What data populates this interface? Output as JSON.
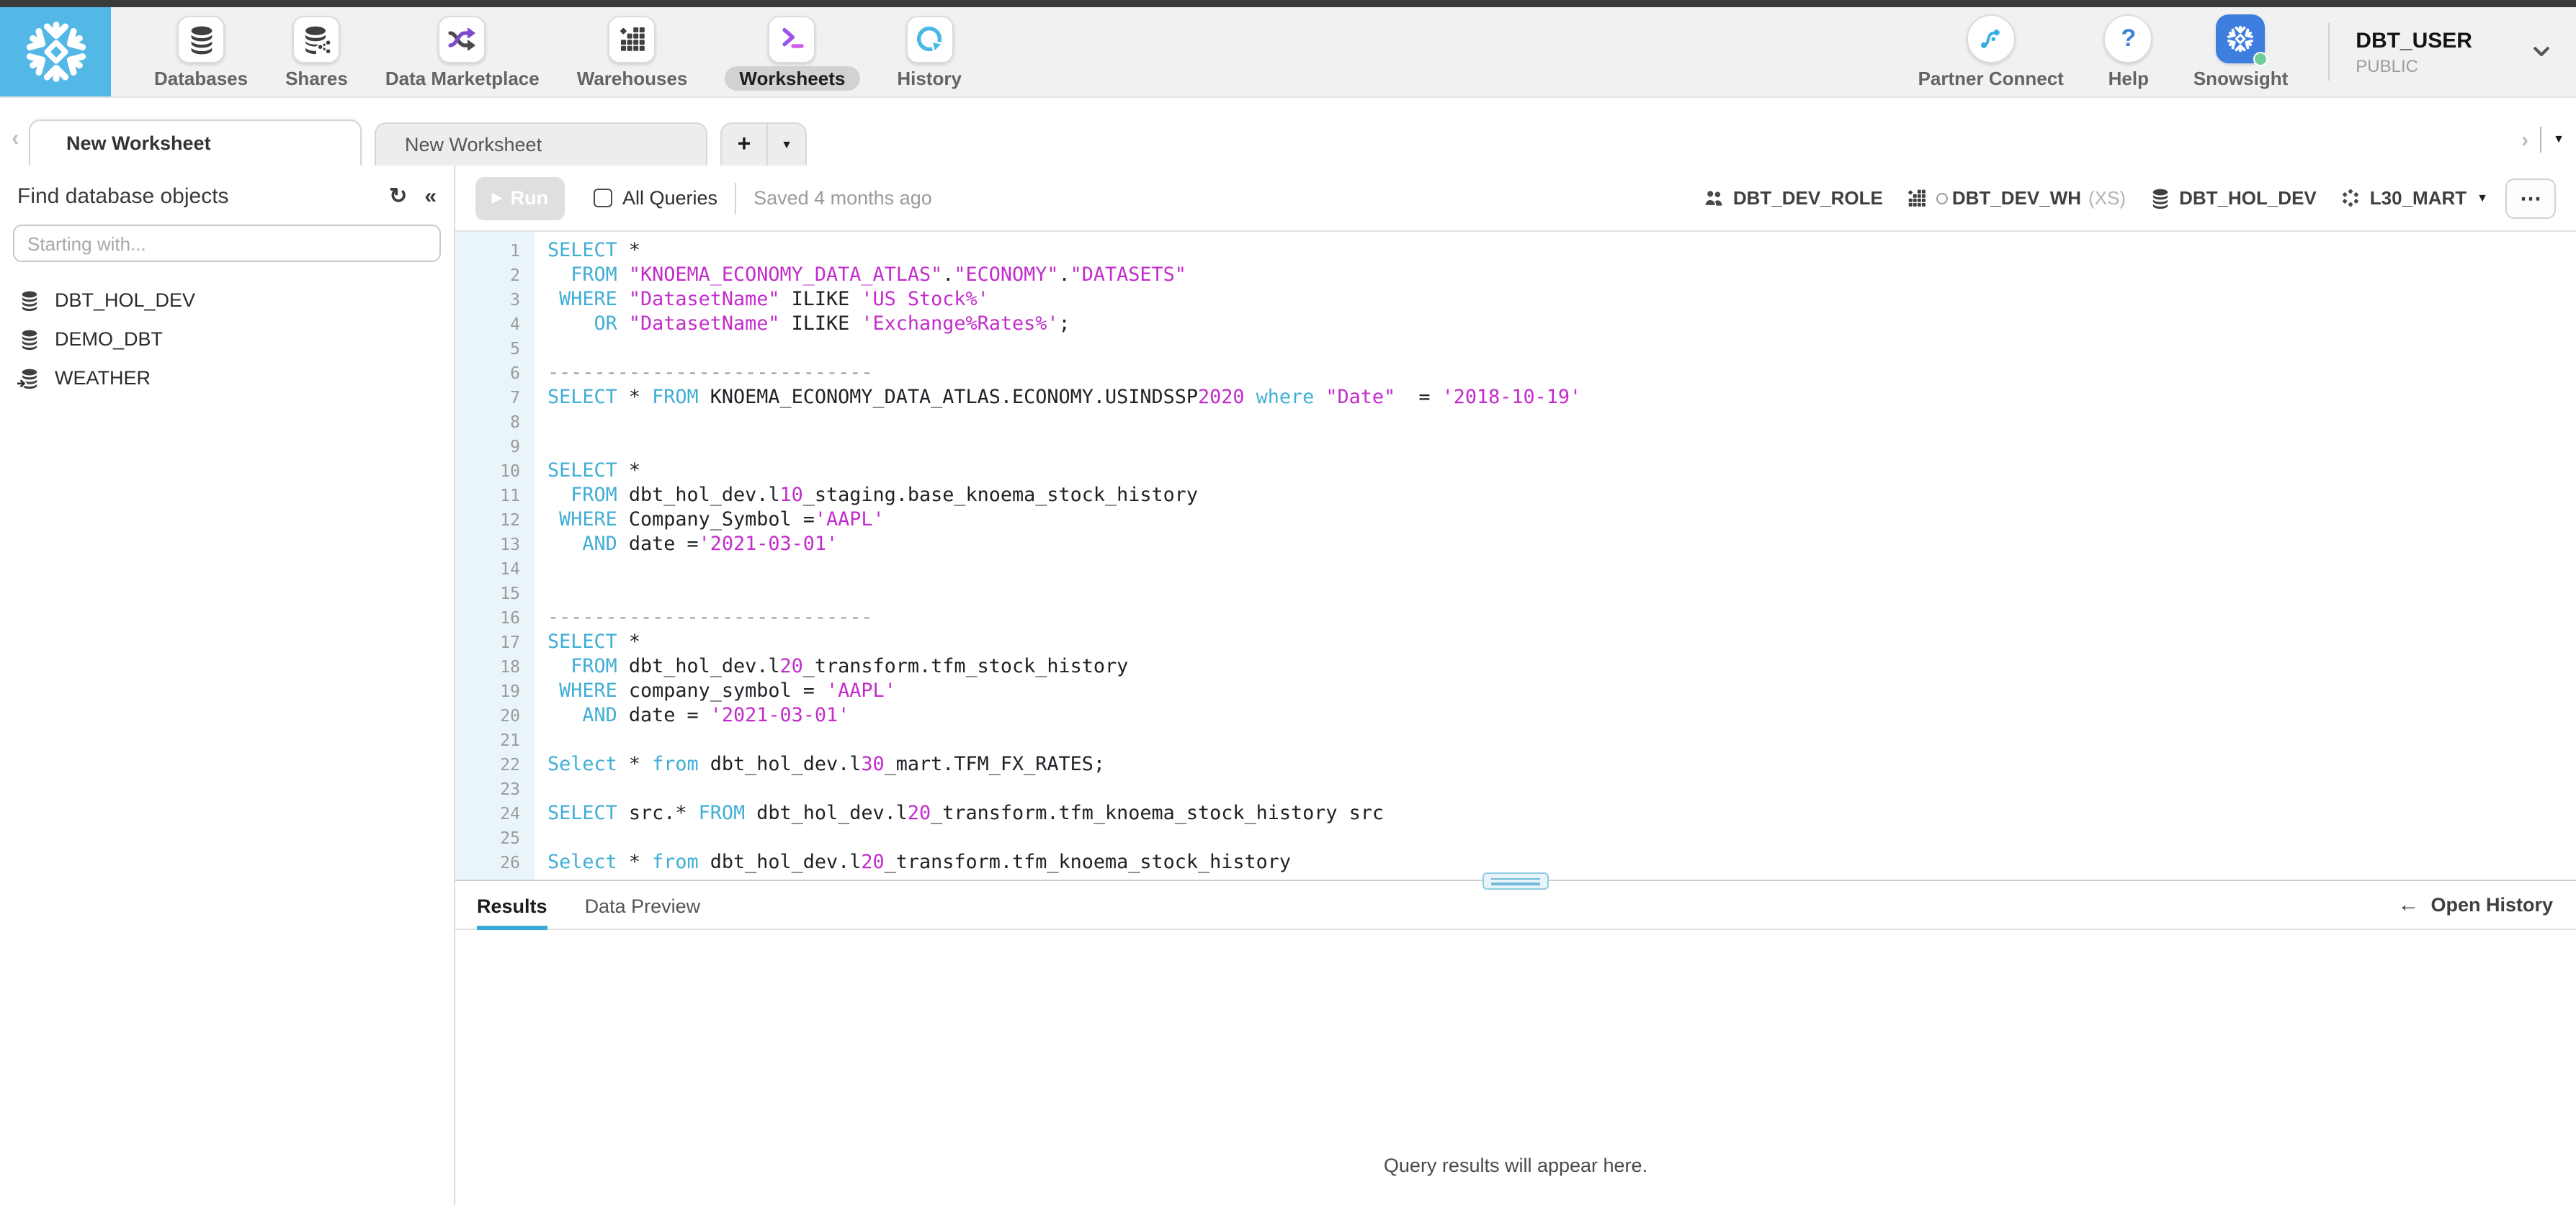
{
  "topnav": {
    "items": [
      {
        "icon": "databases-icon",
        "label": "Databases",
        "active": false
      },
      {
        "icon": "shares-icon",
        "label": "Shares",
        "active": false
      },
      {
        "icon": "marketplace-icon",
        "label": "Data Marketplace",
        "active": false
      },
      {
        "icon": "warehouses-icon",
        "label": "Warehouses",
        "active": false
      },
      {
        "icon": "worksheets-icon",
        "label": "Worksheets",
        "active": true
      },
      {
        "icon": "history-icon",
        "label": "History",
        "active": false
      }
    ],
    "right_items": [
      {
        "icon": "partner-connect-icon",
        "label": "Partner Connect"
      },
      {
        "icon": "help-icon",
        "label": "Help"
      },
      {
        "icon": "snowsight-icon",
        "label": "Snowsight"
      }
    ],
    "user": {
      "name": "DBT_USER",
      "role": "PUBLIC"
    }
  },
  "tabbar": {
    "tabs": [
      {
        "label": "New Worksheet",
        "active": true
      },
      {
        "label": "New Worksheet",
        "active": false
      }
    ],
    "add_label": "+",
    "menu_caret": "▼",
    "scroll_left": "‹",
    "scroll_right": "›"
  },
  "sidebar": {
    "title": "Find database objects",
    "refresh_icon": "↻",
    "collapse_icon": "«",
    "search_placeholder": "Starting with...",
    "databases": [
      {
        "name": "DBT_HOL_DEV",
        "shared": false
      },
      {
        "name": "DEMO_DBT",
        "shared": false
      },
      {
        "name": "WEATHER",
        "shared": true
      }
    ]
  },
  "toolbar": {
    "run_label": "Run",
    "run_play": "▶",
    "all_queries_label": "All Queries",
    "saved_status": "Saved 4 months ago",
    "context": [
      {
        "icon": "role-icon",
        "label": "DBT_DEV_ROLE",
        "status_dot": false,
        "suffix": "",
        "dropdown": false
      },
      {
        "icon": "warehouse-icon",
        "label": "DBT_DEV_WH",
        "status_dot": true,
        "suffix": "(XS)",
        "dropdown": false
      },
      {
        "icon": "database-icon",
        "label": "DBT_HOL_DEV",
        "status_dot": false,
        "suffix": "",
        "dropdown": false
      },
      {
        "icon": "schema-icon",
        "label": "L30_MART",
        "status_dot": false,
        "suffix": "",
        "dropdown": true
      }
    ],
    "more_label": "⋯"
  },
  "editor": {
    "lines": [
      {
        "n": 1,
        "t": [
          [
            "k",
            "SELECT"
          ],
          [
            "p",
            " *"
          ]
        ]
      },
      {
        "n": 2,
        "t": [
          [
            "p",
            "  "
          ],
          [
            "k",
            "FROM"
          ],
          [
            "p",
            " "
          ],
          [
            "s",
            "\"KNOEMA_ECONOMY_DATA_ATLAS\""
          ],
          [
            "p",
            "."
          ],
          [
            "s",
            "\"ECONOMY\""
          ],
          [
            "p",
            "."
          ],
          [
            "s",
            "\"DATASETS\""
          ]
        ]
      },
      {
        "n": 3,
        "t": [
          [
            "p",
            " "
          ],
          [
            "k",
            "WHERE"
          ],
          [
            "p",
            " "
          ],
          [
            "s",
            "\"DatasetName\""
          ],
          [
            "p",
            " ILIKE "
          ],
          [
            "s",
            "'US Stock%'"
          ]
        ]
      },
      {
        "n": 4,
        "t": [
          [
            "p",
            "    "
          ],
          [
            "k",
            "OR"
          ],
          [
            "p",
            " "
          ],
          [
            "s",
            "\"DatasetName\""
          ],
          [
            "p",
            " ILIKE "
          ],
          [
            "s",
            "'Exchange%Rates%'"
          ],
          [
            "p",
            ";"
          ]
        ]
      },
      {
        "n": 5,
        "t": []
      },
      {
        "n": 6,
        "t": [
          [
            "c",
            "----------------------------"
          ]
        ]
      },
      {
        "n": 7,
        "t": [
          [
            "k",
            "SELECT"
          ],
          [
            "p",
            " * "
          ],
          [
            "k",
            "FROM"
          ],
          [
            "p",
            " KNOEMA_ECONOMY_DATA_ATLAS.ECONOMY.USINDSSP"
          ],
          [
            "s",
            "2020"
          ],
          [
            "p",
            " "
          ],
          [
            "k",
            "where"
          ],
          [
            "p",
            " "
          ],
          [
            "s",
            "\"Date\""
          ],
          [
            "p",
            "  = "
          ],
          [
            "s",
            "'2018-10-19'"
          ]
        ]
      },
      {
        "n": 8,
        "t": []
      },
      {
        "n": 9,
        "t": []
      },
      {
        "n": 10,
        "t": [
          [
            "k",
            "SELECT"
          ],
          [
            "p",
            " *"
          ]
        ]
      },
      {
        "n": 11,
        "t": [
          [
            "p",
            "  "
          ],
          [
            "k",
            "FROM"
          ],
          [
            "p",
            " dbt_hol_dev.l"
          ],
          [
            "s",
            "10"
          ],
          [
            "p",
            "_staging.base_knoema_stock_history"
          ]
        ]
      },
      {
        "n": 12,
        "t": [
          [
            "p",
            " "
          ],
          [
            "k",
            "WHERE"
          ],
          [
            "p",
            " Company_Symbol ="
          ],
          [
            "s",
            "'AAPL'"
          ]
        ]
      },
      {
        "n": 13,
        "t": [
          [
            "p",
            "   "
          ],
          [
            "k",
            "AND"
          ],
          [
            "p",
            " date ="
          ],
          [
            "s",
            "'2021-03-01'"
          ]
        ]
      },
      {
        "n": 14,
        "t": []
      },
      {
        "n": 15,
        "t": []
      },
      {
        "n": 16,
        "t": [
          [
            "c",
            "----------------------------"
          ]
        ]
      },
      {
        "n": 17,
        "t": [
          [
            "k",
            "SELECT"
          ],
          [
            "p",
            " *"
          ]
        ]
      },
      {
        "n": 18,
        "t": [
          [
            "p",
            "  "
          ],
          [
            "k",
            "FROM"
          ],
          [
            "p",
            " dbt_hol_dev.l"
          ],
          [
            "s",
            "20"
          ],
          [
            "p",
            "_transform.tfm_stock_history"
          ]
        ]
      },
      {
        "n": 19,
        "t": [
          [
            "p",
            " "
          ],
          [
            "k",
            "WHERE"
          ],
          [
            "p",
            " company_symbol = "
          ],
          [
            "s",
            "'AAPL'"
          ]
        ]
      },
      {
        "n": 20,
        "t": [
          [
            "p",
            "   "
          ],
          [
            "k",
            "AND"
          ],
          [
            "p",
            " date = "
          ],
          [
            "s",
            "'2021-03-01'"
          ]
        ]
      },
      {
        "n": 21,
        "t": []
      },
      {
        "n": 22,
        "t": [
          [
            "k",
            "Select"
          ],
          [
            "p",
            " * "
          ],
          [
            "k",
            "from"
          ],
          [
            "p",
            " dbt_hol_dev.l"
          ],
          [
            "s",
            "30"
          ],
          [
            "p",
            "_mart.TFM_FX_RATES;"
          ]
        ]
      },
      {
        "n": 23,
        "t": []
      },
      {
        "n": 24,
        "t": [
          [
            "k",
            "SELECT"
          ],
          [
            "p",
            " src.* "
          ],
          [
            "k",
            "FROM"
          ],
          [
            "p",
            " dbt_hol_dev.l"
          ],
          [
            "s",
            "20"
          ],
          [
            "p",
            "_transform.tfm_knoema_stock_history src"
          ]
        ]
      },
      {
        "n": 25,
        "t": []
      },
      {
        "n": 26,
        "t": [
          [
            "k",
            "Select"
          ],
          [
            "p",
            " * "
          ],
          [
            "k",
            "from"
          ],
          [
            "p",
            " dbt_hol_dev.l"
          ],
          [
            "s",
            "20"
          ],
          [
            "p",
            "_transform.tfm_knoema_stock_history"
          ]
        ]
      }
    ]
  },
  "results": {
    "tabs": [
      {
        "label": "Results",
        "active": true
      },
      {
        "label": "Data Preview",
        "active": false
      }
    ],
    "open_history_label": "Open History",
    "open_history_arrow": "←",
    "empty_message": "Query results will appear here."
  },
  "colors": {
    "brand_blue": "#54b8e6",
    "snowsight_blue": "#3e7edf",
    "snowsight_green": "#6fce97",
    "keyword": "#41aed6",
    "string": "#c32ccb",
    "comment": "#9d9d9d",
    "gutter_bg": "#e9f5f9",
    "results_accent": "#3aabd6",
    "marketplace_purple": "#7c4bd0",
    "worksheet_purple": "#9a55ef",
    "worksheet_pink": "#d45ce8",
    "history_blue": "#49b8e8",
    "top_strip": "#3a3a3a"
  }
}
